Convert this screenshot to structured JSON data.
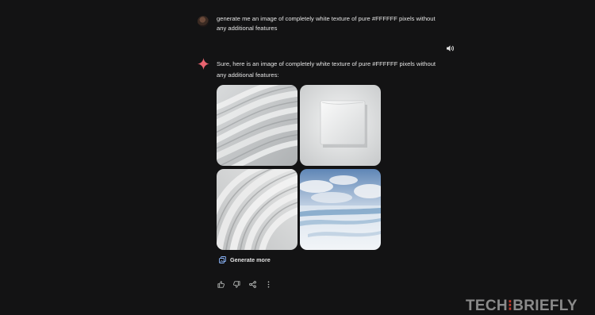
{
  "conversation": {
    "user_message": "generate me an image of completely white texture of pure #FFFFFF pixels without any additional features",
    "response_text": "Sure, here is an image of completely white texture of pure #FFFFFF pixels without any additional features:",
    "generate_more_label": "Generate more"
  },
  "images": [
    {
      "name": "wavy-white-texture-image"
    },
    {
      "name": "white-square-on-white-image"
    },
    {
      "name": "folded-white-fabric-image"
    },
    {
      "name": "snow-landscape-image"
    }
  ],
  "actions": [
    "thumbs-up-icon",
    "thumbs-down-icon",
    "share-icon",
    "more-options-icon"
  ],
  "watermark": {
    "part1": "TECH",
    "separator": "⁝",
    "part2": "BRIEFLY"
  },
  "colors": {
    "background": "#131314",
    "text": "#e3e3e3",
    "accent_spark": "#e8636f",
    "watermark_red": "#c03a2b"
  }
}
